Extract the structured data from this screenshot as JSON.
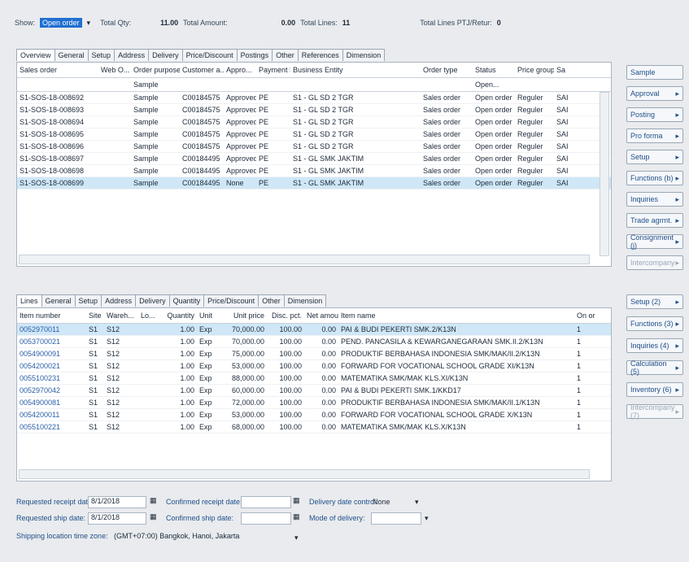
{
  "topbar": {
    "show_label": "Show:",
    "show_value": "Open order",
    "total_qty_label": "Total Qty:",
    "total_qty": "11.00",
    "total_amount_label": "Total Amount:",
    "total_amount": "0.00",
    "total_lines_label": "Total Lines:",
    "total_lines": "11",
    "total_lines_ptj_label": "Total Lines PTJ/Retur:",
    "total_lines_ptj": "0"
  },
  "header_tabs": [
    "Overview",
    "General",
    "Setup",
    "Address",
    "Delivery",
    "Price/Discount",
    "Postings",
    "Other",
    "References",
    "Dimension"
  ],
  "orders": {
    "columns": [
      "Sales order",
      "Web O...",
      "Order purpose",
      "Customer a...",
      "Appro...",
      "Payment ID",
      "Business Entity",
      "Order type",
      "Status",
      "Price group",
      "Sa"
    ],
    "filter_purpose": "Sample",
    "filter_status": "Open...",
    "rows": [
      {
        "so": "S1-SOS-18-008692",
        "purpose": "Sample",
        "cust": "C00184575",
        "appr": "Approved",
        "pay": "PE",
        "be": "S1 - GL SD 2 TGR",
        "type": "Sales order",
        "status": "Open order",
        "pg": "Reguler",
        "sa": "SAI"
      },
      {
        "so": "S1-SOS-18-008693",
        "purpose": "Sample",
        "cust": "C00184575",
        "appr": "Approved",
        "pay": "PE",
        "be": "S1 - GL SD 2 TGR",
        "type": "Sales order",
        "status": "Open order",
        "pg": "Reguler",
        "sa": "SAI"
      },
      {
        "so": "S1-SOS-18-008694",
        "purpose": "Sample",
        "cust": "C00184575",
        "appr": "Approved",
        "pay": "PE",
        "be": "S1 - GL SD 2 TGR",
        "type": "Sales order",
        "status": "Open order",
        "pg": "Reguler",
        "sa": "SAI"
      },
      {
        "so": "S1-SOS-18-008695",
        "purpose": "Sample",
        "cust": "C00184575",
        "appr": "Approved",
        "pay": "PE",
        "be": "S1 - GL SD 2 TGR",
        "type": "Sales order",
        "status": "Open order",
        "pg": "Reguler",
        "sa": "SAI"
      },
      {
        "so": "S1-SOS-18-008696",
        "purpose": "Sample",
        "cust": "C00184575",
        "appr": "Approved",
        "pay": "PE",
        "be": "S1 - GL SD 2 TGR",
        "type": "Sales order",
        "status": "Open order",
        "pg": "Reguler",
        "sa": "SAI"
      },
      {
        "so": "S1-SOS-18-008697",
        "purpose": "Sample",
        "cust": "C00184495",
        "appr": "Approved",
        "pay": "PE",
        "be": "S1 - GL SMK JAKTIM",
        "type": "Sales order",
        "status": "Open order",
        "pg": "Reguler",
        "sa": "SAI"
      },
      {
        "so": "S1-SOS-18-008698",
        "purpose": "Sample",
        "cust": "C00184495",
        "appr": "Approved",
        "pay": "PE",
        "be": "S1 - GL SMK JAKTIM",
        "type": "Sales order",
        "status": "Open order",
        "pg": "Reguler",
        "sa": "SAI"
      },
      {
        "so": "S1-SOS-18-008699",
        "purpose": "Sample",
        "cust": "C00184495",
        "appr": "None",
        "pay": "PE",
        "be": "S1 - GL SMK JAKTIM",
        "type": "Sales order",
        "status": "Open order",
        "pg": "Reguler",
        "sa": "SAI"
      }
    ]
  },
  "header_buttons": [
    "Sample",
    "Approval",
    "Posting",
    "Pro forma",
    "Setup",
    "Functions (b)",
    "Inquiries",
    "Trade agrmt.",
    "Consignment (j)",
    "Intercompany"
  ],
  "line_tabs": [
    "Lines",
    "General",
    "Setup",
    "Address",
    "Delivery",
    "Quantity",
    "Price/Discount",
    "Other",
    "Dimension"
  ],
  "lines": {
    "columns": [
      "Item number",
      "Site",
      "Wareh...",
      "Lo...",
      "Quantity",
      "Unit",
      "Unit price",
      "Disc. pct.",
      "Net amount",
      "Item name",
      "On or"
    ],
    "rows": [
      {
        "item": "0052970011",
        "site": "S1",
        "wh": "S12",
        "qty": "1.00",
        "unit": "Exp",
        "price": "70,000.00",
        "disc": "100.00",
        "net": "0.00",
        "name": "PAI & BUDI PEKERTI SMK.2/K13N",
        "onor": "1"
      },
      {
        "item": "0053700021",
        "site": "S1",
        "wh": "S12",
        "qty": "1.00",
        "unit": "Exp",
        "price": "70,000.00",
        "disc": "100.00",
        "net": "0.00",
        "name": "PEND. PANCASILA & KEWARGANEGARAAN SMK.II.2/K13N",
        "onor": "1"
      },
      {
        "item": "0054900091",
        "site": "S1",
        "wh": "S12",
        "qty": "1.00",
        "unit": "Exp",
        "price": "75,000.00",
        "disc": "100.00",
        "net": "0.00",
        "name": "PRODUKTIF BERBAHASA INDONESIA SMK/MAK/II.2/K13N",
        "onor": "1"
      },
      {
        "item": "0054200021",
        "site": "S1",
        "wh": "S12",
        "qty": "1.00",
        "unit": "Exp",
        "price": "53,000.00",
        "disc": "100.00",
        "net": "0.00",
        "name": "FORWARD FOR VOCATIONAL SCHOOL GRADE XI/K13N",
        "onor": "1"
      },
      {
        "item": "0055100231",
        "site": "S1",
        "wh": "S12",
        "qty": "1.00",
        "unit": "Exp",
        "price": "88,000.00",
        "disc": "100.00",
        "net": "0.00",
        "name": "MATEMATIKA SMK/MAK KLS.XI/K13N",
        "onor": "1"
      },
      {
        "item": "0052970042",
        "site": "S1",
        "wh": "S12",
        "qty": "1.00",
        "unit": "Exp",
        "price": "60,000.00",
        "disc": "100.00",
        "net": "0.00",
        "name": "PAI & BUDI PEKERTI SMK.1/KKD17",
        "onor": "1"
      },
      {
        "item": "0054900081",
        "site": "S1",
        "wh": "S12",
        "qty": "1.00",
        "unit": "Exp",
        "price": "72,000.00",
        "disc": "100.00",
        "net": "0.00",
        "name": "PRODUKTIF BERBAHASA INDONESIA SMK/MAK/II.1/K13N",
        "onor": "1"
      },
      {
        "item": "0054200011",
        "site": "S1",
        "wh": "S12",
        "qty": "1.00",
        "unit": "Exp",
        "price": "53,000.00",
        "disc": "100.00",
        "net": "0.00",
        "name": "FORWARD FOR VOCATIONAL SCHOOL GRADE X/K13N",
        "onor": "1"
      },
      {
        "item": "0055100221",
        "site": "S1",
        "wh": "S12",
        "qty": "1.00",
        "unit": "Exp",
        "price": "68,000.00",
        "disc": "100.00",
        "net": "0.00",
        "name": "MATEMATIKA SMK/MAK KLS.X/K13N",
        "onor": "1"
      }
    ]
  },
  "line_buttons": [
    "Setup (2)",
    "Functions (3)",
    "Inquiries (4)",
    "Calculation (5)",
    "Inventory (6)",
    "Intercompany (7)"
  ],
  "form": {
    "req_receipt_label": "Requested receipt date:",
    "req_receipt": "8/1/2018",
    "req_ship_label": "Requested ship date:",
    "req_ship": "8/1/2018",
    "conf_receipt_label": "Confirmed receipt date:",
    "conf_ship_label": "Confirmed ship date:",
    "delivery_control_label": "Delivery date control:",
    "delivery_control": "None",
    "mode_delivery_label": "Mode of delivery:",
    "tz_label": "Shipping location time zone:",
    "tz": "(GMT+07:00) Bangkok, Hanoi, Jakarta"
  }
}
